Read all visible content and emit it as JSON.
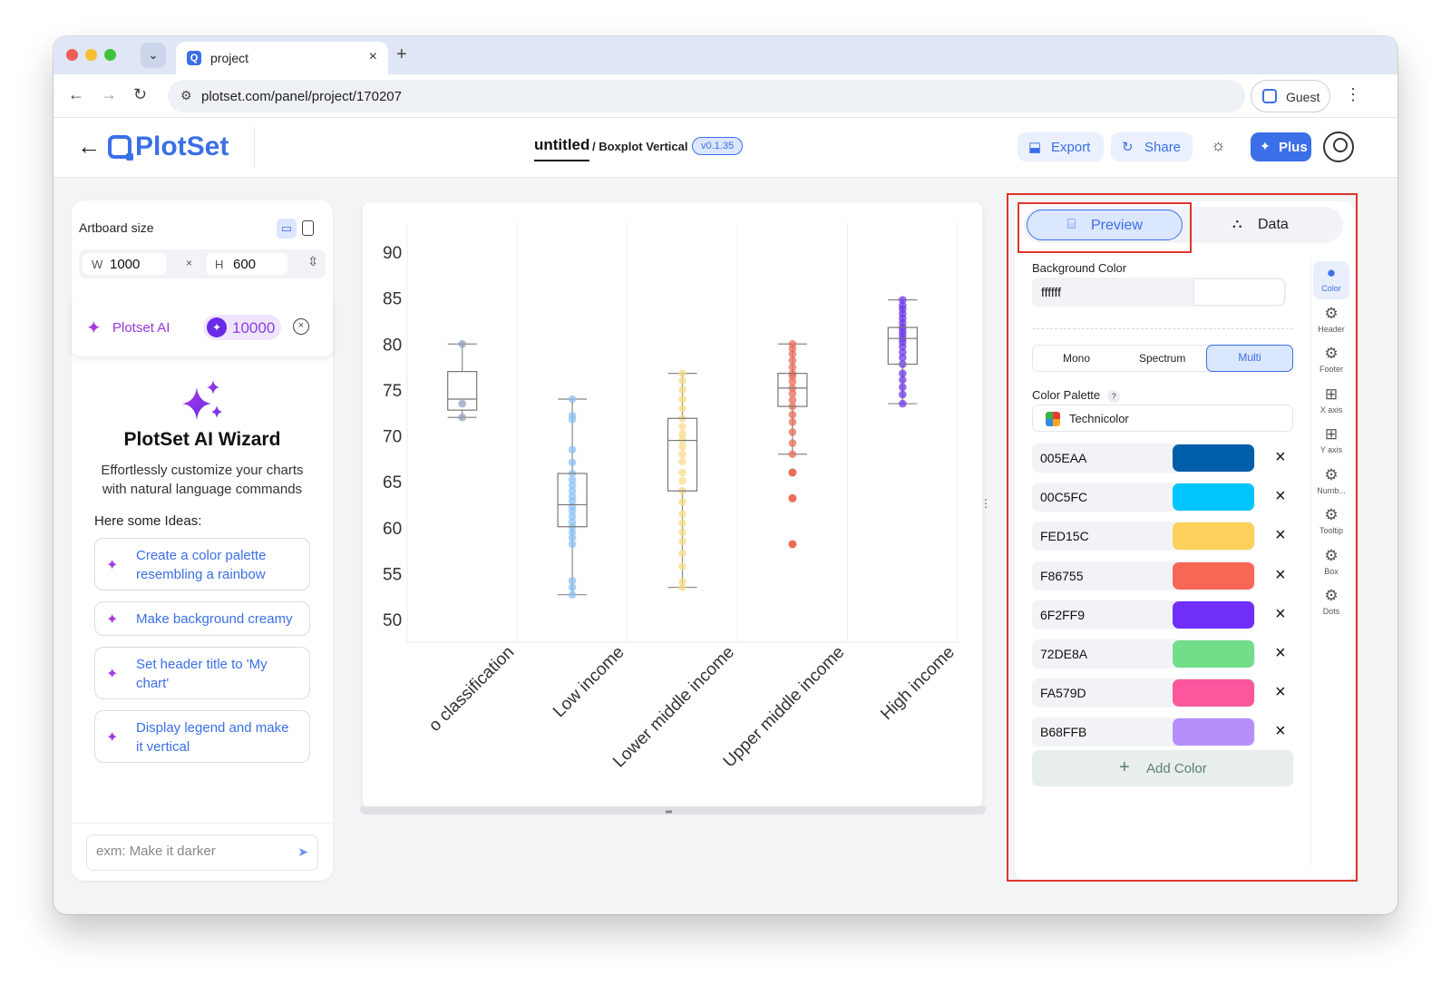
{
  "browser": {
    "tab_title": "project",
    "url": "plotset.com/panel/project/170207",
    "guest_label": "Guest"
  },
  "app": {
    "logo_text": "PlotSet",
    "project_title": "untitled",
    "chart_type": "/ Boxplot Vertical",
    "version": "v0.1.35",
    "export_label": "Export",
    "share_label": "Share",
    "plus_label": "Plus"
  },
  "left_panel": {
    "artboard_label": "Artboard size",
    "width_prefix": "W",
    "width_value": "1000",
    "times": "×",
    "height_prefix": "H",
    "height_value": "600",
    "ai_label": "Plotset AI",
    "credits": "10000",
    "wizard_title": "PlotSet AI Wizard",
    "wizard_description": "Effortlessly customize your charts with natural language commands",
    "ideas_heading": "Here some Ideas:",
    "ideas": [
      "Create a color palette resembling a rainbow",
      "Make background creamy",
      "Set header title to 'My chart'",
      "Display legend and make it vertical"
    ],
    "input_placeholder": "exm: Make it darker"
  },
  "chart_data": {
    "type": "boxplot",
    "categories": [
      "No classification",
      "Low income",
      "Lower middle income",
      "Upper middle income",
      "High income"
    ],
    "category_labels_visible": [
      "o classification",
      "Low income",
      "Lower middle income",
      "Upper middle income",
      "High income"
    ],
    "y_ticks": [
      50,
      55,
      60,
      65,
      70,
      75,
      80,
      85,
      90
    ],
    "ylim": [
      48,
      92
    ],
    "grid": "vertical only",
    "colors": [
      "#8fa0bd",
      "#8ec2f2",
      "#f5dc8a",
      "#eb6c5a",
      "#6f3ae8"
    ],
    "series": [
      {
        "name": "No classification",
        "min": 72,
        "q1": 72.8,
        "median": 74,
        "q3": 77,
        "max": 80,
        "points": [
          72,
          73.5,
          80
        ]
      },
      {
        "name": "Low income",
        "min": 52.7,
        "q1": 60.1,
        "median": 62.5,
        "q3": 65.9,
        "max": 74,
        "points": [
          52.7,
          53.5,
          54.2,
          58.2,
          58.9,
          59.5,
          60.1,
          60.6,
          61.2,
          61.8,
          62.3,
          62.9,
          63.4,
          64,
          64.6,
          65.2,
          65.9,
          67.1,
          68.5,
          71.8,
          72.2,
          74
        ]
      },
      {
        "name": "Lower middle income",
        "min": 53.5,
        "q1": 64,
        "median": 69.5,
        "q3": 71.9,
        "max": 76.8,
        "points": [
          53.5,
          54.1,
          55.8,
          57.2,
          58.5,
          59.5,
          60.5,
          61.5,
          62.8,
          64,
          65.1,
          66,
          67.2,
          68,
          68.8,
          69.5,
          70.2,
          71,
          71.9,
          73,
          74,
          75,
          76,
          76.8
        ]
      },
      {
        "name": "Upper middle income",
        "min": 68,
        "q1": 73.2,
        "median": 75.2,
        "q3": 76.8,
        "max": 80,
        "outliers": [
          58.2,
          63.2,
          66
        ],
        "points": [
          68,
          69.2,
          70.4,
          71.5,
          72.3,
          73.2,
          73.9,
          74.6,
          75.2,
          75.9,
          76.5,
          76.8,
          77.5,
          78.2,
          78.9,
          79.5,
          80
        ]
      },
      {
        "name": "High income",
        "min": 73.5,
        "q1": 77.8,
        "median": 80.6,
        "q3": 81.8,
        "max": 84.8,
        "points": [
          73.5,
          74.5,
          75.3,
          76.1,
          76.8,
          77.8,
          78.5,
          79.1,
          79.7,
          80.2,
          80.6,
          81,
          81.4,
          81.8,
          82.3,
          82.8,
          83.3,
          83.8,
          84.2,
          84.8
        ]
      }
    ]
  },
  "right_panel": {
    "tab_preview": "Preview",
    "tab_data": "Data",
    "bg_color_label": "Background Color",
    "bg_color_value": "ffffff",
    "modes": [
      "Mono",
      "Spectrum",
      "Multi"
    ],
    "active_mode": "Multi",
    "color_palette_label": "Color Palette",
    "help_mark": "?",
    "palette_name": "Technicolor",
    "colors": [
      "005EAA",
      "00C5FC",
      "FED15C",
      "F86755",
      "6F2FF9",
      "72DE8A",
      "FA579D",
      "B68FFB"
    ],
    "add_color_label": "Add Color",
    "rail": [
      "Color",
      "Header",
      "Footer",
      "X axis",
      "Y axis",
      "Numb...",
      "Tooltip",
      "Box",
      "Dots"
    ]
  }
}
